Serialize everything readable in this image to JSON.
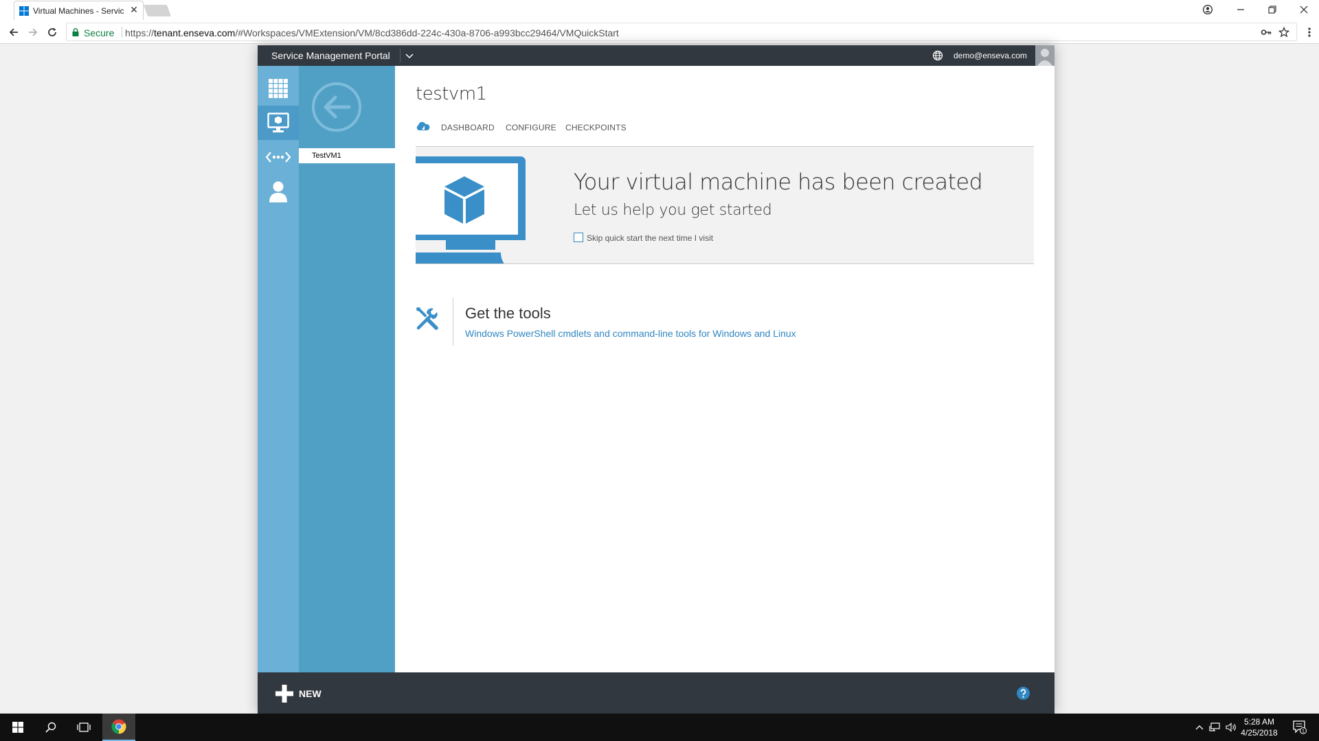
{
  "browser": {
    "tab_title": "Virtual Machines - Servic",
    "tab_close": "✕",
    "secure_label": "Secure",
    "url_prefix": "https://",
    "url_host": "tenant.enseva.com",
    "url_path": "/#Workspaces/VMExtension/VM/8cd386dd-224c-430a-8706-a993bcc29464/VMQuickStart"
  },
  "portal": {
    "title": "Service Management Portal",
    "user_email": "demo@enseva.com"
  },
  "left_nav": {
    "items": [
      "all-items-icon",
      "virtual-machines-icon",
      "networks-icon",
      "account-icon"
    ],
    "selected": "virtual-machines-icon"
  },
  "second_nav": {
    "items": [
      {
        "label": "TestVM1"
      }
    ]
  },
  "vm": {
    "name": "testvm1",
    "tabs": [
      "DASHBOARD",
      "CONFIGURE",
      "CHECKPOINTS"
    ]
  },
  "quickstart": {
    "heading": "Your virtual machine has been created",
    "subheading": "Let us help you get started",
    "skip_label": "Skip quick start the next time I visit",
    "skip_checked": false
  },
  "tools": {
    "heading": "Get the tools",
    "link": "Windows PowerShell cmdlets and command-line tools for Windows and Linux"
  },
  "bottom_bar": {
    "new_label": "NEW"
  },
  "taskbar": {
    "time": "5:28 AM",
    "date": "4/25/2018",
    "notification_count": "1"
  },
  "colors": {
    "accent_blue": "#3a8fc8",
    "dark_bar": "#32383f",
    "left_nav": "#6bb0d6",
    "second_nav": "#50a0c6"
  }
}
